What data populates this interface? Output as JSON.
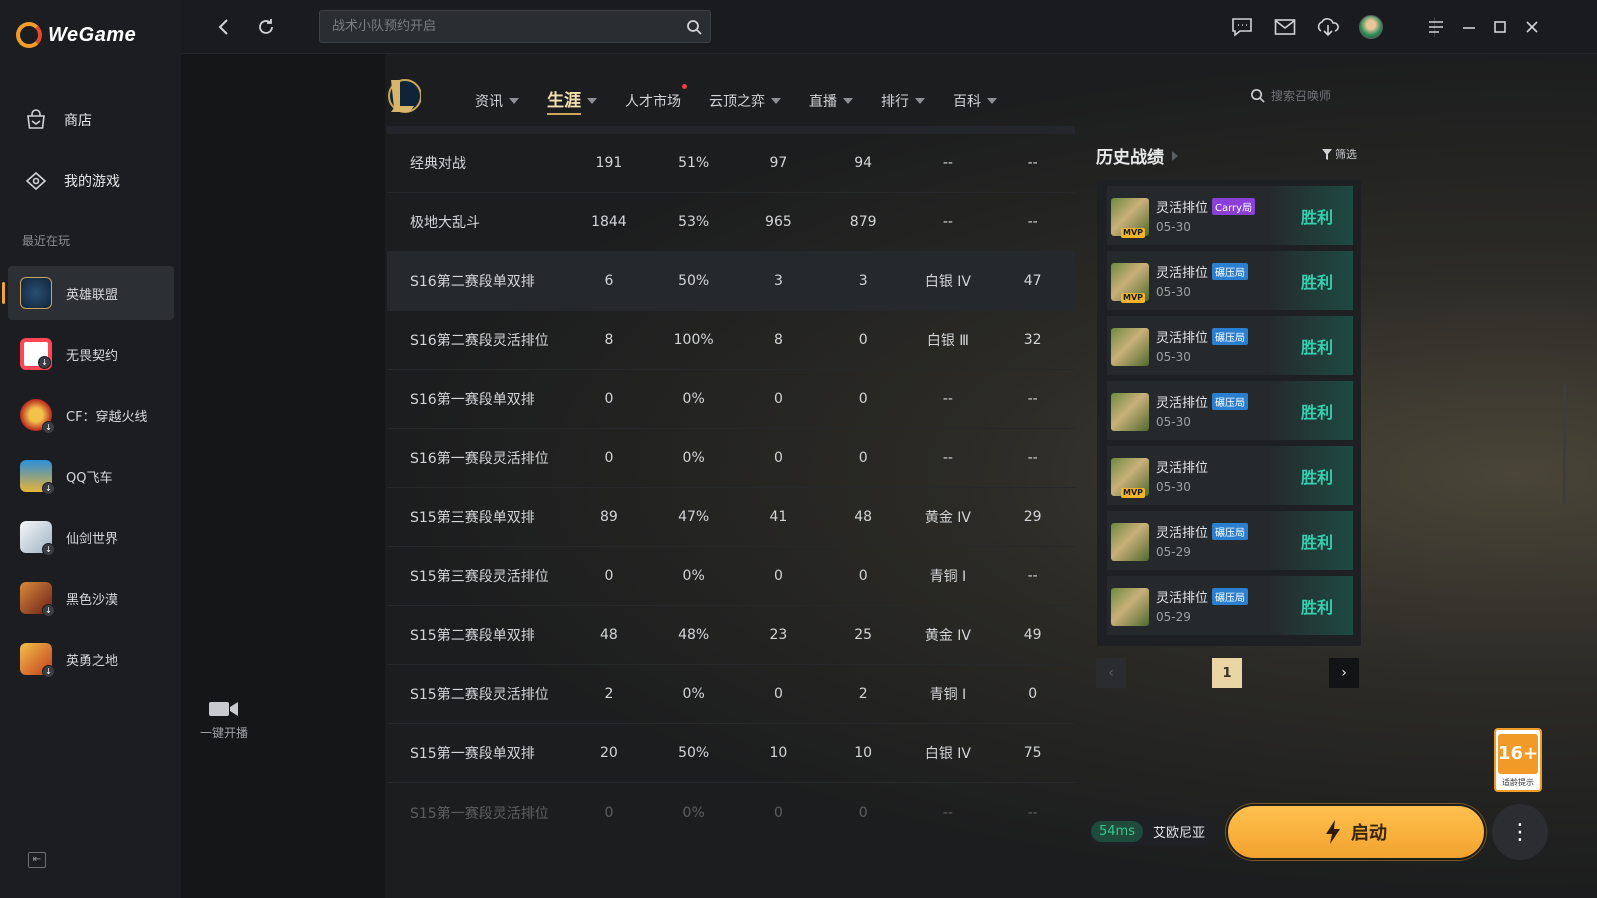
{
  "brand": {
    "name": "WeGame"
  },
  "sidebar": {
    "nav": [
      {
        "label": "商店",
        "icon": "shop-bag-icon"
      },
      {
        "label": "我的游戏",
        "icon": "gamepad-icon"
      }
    ],
    "recent_label": "最近在玩",
    "games": [
      {
        "label": "英雄联盟",
        "color": "#1c3b5a",
        "active": true
      },
      {
        "label": "无畏契约",
        "color": "#ff4655",
        "active": false
      },
      {
        "label": "CF：穿越火线",
        "color": "#b8281f",
        "active": false
      },
      {
        "label": "QQ飞车",
        "color": "#e8b33a",
        "active": false
      },
      {
        "label": "仙剑世界",
        "color": "#dbe3ea",
        "active": false
      },
      {
        "label": "黑色沙漠",
        "color": "#8f2d1f",
        "active": false
      },
      {
        "label": "英勇之地",
        "color": "#c43c1e",
        "active": false
      }
    ],
    "stream_label": "一键开播"
  },
  "topbar": {
    "search_placeholder": "战术小队预约开启"
  },
  "nav_tabs": [
    {
      "label": "资讯",
      "active": false,
      "dot": false,
      "caret": true
    },
    {
      "label": "生涯",
      "active": true,
      "dot": false,
      "caret": true
    },
    {
      "label": "人才市场",
      "active": false,
      "dot": true,
      "caret": false
    },
    {
      "label": "云顶之弈",
      "active": false,
      "dot": false,
      "caret": true
    },
    {
      "label": "直播",
      "active": false,
      "dot": false,
      "caret": true
    },
    {
      "label": "排行",
      "active": false,
      "dot": false,
      "caret": true
    },
    {
      "label": "百科",
      "active": false,
      "dot": false,
      "caret": true
    }
  ],
  "summoner_search_placeholder": "搜索召唤师",
  "stats_rows": [
    [
      "经典对战",
      "191",
      "51%",
      "97",
      "94",
      "--",
      "--"
    ],
    [
      "极地大乱斗",
      "1844",
      "53%",
      "965",
      "879",
      "--",
      "--"
    ],
    [
      "S16第二赛段单双排",
      "6",
      "50%",
      "3",
      "3",
      "白银 IV",
      "47"
    ],
    [
      "S16第二赛段灵活排位",
      "8",
      "100%",
      "8",
      "0",
      "白银 Ⅲ",
      "32"
    ],
    [
      "S16第一赛段单双排",
      "0",
      "0%",
      "0",
      "0",
      "--",
      "--"
    ],
    [
      "S16第一赛段灵活排位",
      "0",
      "0%",
      "0",
      "0",
      "--",
      "--"
    ],
    [
      "S15第三赛段单双排",
      "89",
      "47%",
      "41",
      "48",
      "黄金 IV",
      "29"
    ],
    [
      "S15第三赛段灵活排位",
      "0",
      "0%",
      "0",
      "0",
      "青铜 Ⅰ",
      "--"
    ],
    [
      "S15第二赛段单双排",
      "48",
      "48%",
      "23",
      "25",
      "黄金 IV",
      "49"
    ],
    [
      "S15第二赛段灵活排位",
      "2",
      "0%",
      "0",
      "2",
      "青铜 Ⅰ",
      "0"
    ],
    [
      "S15第一赛段单双排",
      "20",
      "50%",
      "10",
      "10",
      "白银 IV",
      "75"
    ],
    [
      "S15第一赛段灵活排位",
      "0",
      "0%",
      "0",
      "0",
      "--",
      "--"
    ]
  ],
  "history": {
    "title": "历史战绩",
    "filter_label": "筛选",
    "matches": [
      {
        "mode": "灵活排位",
        "tag": "Carry局",
        "tag_type": "carry",
        "date": "05-30",
        "mvp": true,
        "result": "胜利"
      },
      {
        "mode": "灵活排位",
        "tag": "碾压局",
        "tag_type": "crush",
        "date": "05-30",
        "mvp": true,
        "result": "胜利"
      },
      {
        "mode": "灵活排位",
        "tag": "碾压局",
        "tag_type": "crush",
        "date": "05-30",
        "mvp": false,
        "result": "胜利"
      },
      {
        "mode": "灵活排位",
        "tag": "碾压局",
        "tag_type": "crush",
        "date": "05-30",
        "mvp": false,
        "result": "胜利"
      },
      {
        "mode": "灵活排位",
        "tag": "",
        "tag_type": "",
        "date": "05-30",
        "mvp": true,
        "result": "胜利"
      },
      {
        "mode": "灵活排位",
        "tag": "碾压局",
        "tag_type": "crush",
        "date": "05-29",
        "mvp": false,
        "result": "胜利"
      },
      {
        "mode": "灵活排位",
        "tag": "碾压局",
        "tag_type": "crush",
        "date": "05-29",
        "mvp": false,
        "result": "胜利"
      }
    ],
    "mvp_label": "MVP",
    "page": "1"
  },
  "bottom": {
    "ping": "54ms",
    "server": "艾欧尼亚",
    "launch_label": "启动",
    "age_rating": "16+",
    "age_note": "适龄提示"
  }
}
